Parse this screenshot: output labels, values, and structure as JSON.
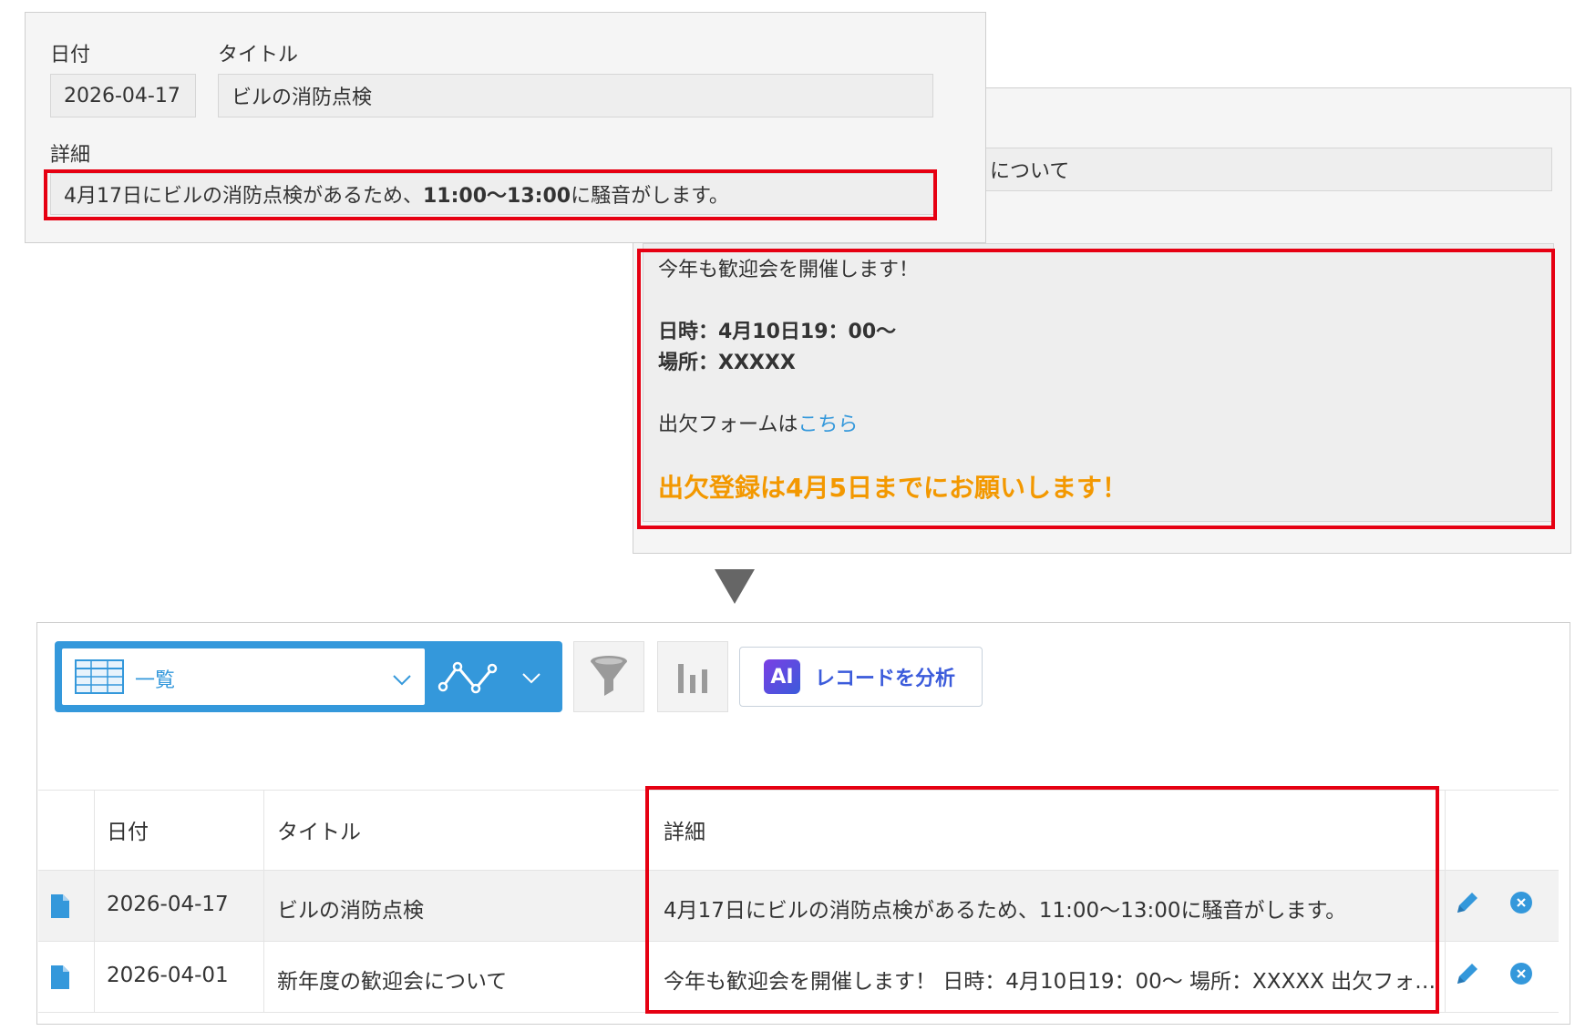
{
  "top_form": {
    "date_label": "日付",
    "title_label": "タイトル",
    "date_value": "2026-04-17",
    "title_value": "ビルの消防点検",
    "detail_label": "詳細",
    "detail_part1": "4月17日にビルの消防点検があるため、",
    "detail_bold": "11:00〜13:00",
    "detail_part2": "に騒音がします。"
  },
  "back_form": {
    "title_partial": "について",
    "detail_line1": "今年も歓迎会を開催します！",
    "detail_line2": "日時：4月10日19：00〜",
    "detail_line3": "場所：XXXXX",
    "detail_line4_prefix": "出欠フォームは",
    "detail_line4_link": "こちら",
    "detail_line5": "出欠登録は4月5日までにお願いします！"
  },
  "toolbar": {
    "view_name": "一覧",
    "ai_button_label": "レコードを分析",
    "ai_badge": "AI"
  },
  "table": {
    "headers": [
      "日付",
      "タイトル",
      "詳細"
    ],
    "rows": [
      {
        "date": "2026-04-17",
        "title": "ビルの消防点検",
        "detail": "4月17日にビルの消防点検があるため、11:00〜13:00に騒音がします。"
      },
      {
        "date": "2026-04-01",
        "title": "新年度の歓迎会について",
        "detail": "今年も歓迎会を開催します！ 日時：4月10日19：00〜 場所：XXXXX 出欠フォ…"
      }
    ]
  },
  "colors": {
    "highlight_border": "#e60012",
    "toolbar_blue": "#3498db",
    "orange_text": "#f39800",
    "link_blue": "#3498db"
  }
}
